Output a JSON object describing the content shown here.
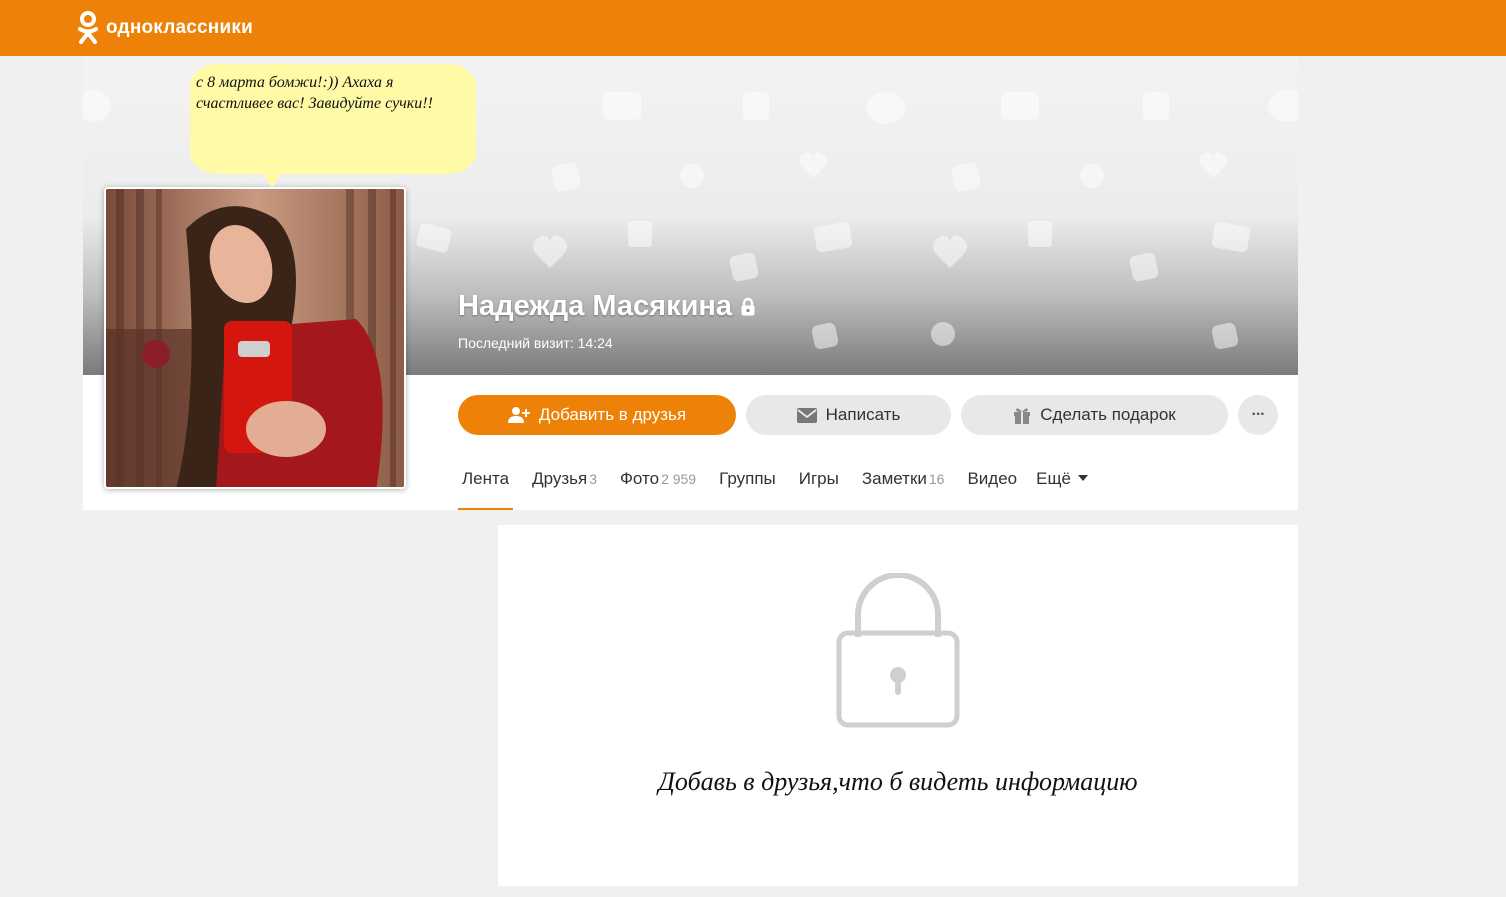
{
  "header": {
    "logo_text": "одноклассники",
    "brand_color": "#ee8208",
    "logo_icon": "ok-logo-icon"
  },
  "profile": {
    "name": "Надежда Масякина",
    "last_visit": "Последний визит: 14:24",
    "privacy_icon": "lock-icon",
    "status_bubble": "с 8 марта бомжи!:)) Ахаха я счастливее вас! Завидуйте сучки!!"
  },
  "actions": {
    "add_friend": "Добавить в друзья",
    "write": "Написать",
    "gift": "Сделать подарок",
    "more": "···"
  },
  "tabs": [
    {
      "label": "Лента",
      "count": ""
    },
    {
      "label": "Друзья",
      "count": "3"
    },
    {
      "label": "Фото",
      "count": "2 959"
    },
    {
      "label": "Группы",
      "count": ""
    },
    {
      "label": "Игры",
      "count": ""
    },
    {
      "label": "Заметки",
      "count": "16"
    },
    {
      "label": "Видео",
      "count": ""
    },
    {
      "label": "Ещё",
      "count": ""
    }
  ],
  "content": {
    "locked_message": "Добавь в друзья,что б видеть информацию"
  }
}
